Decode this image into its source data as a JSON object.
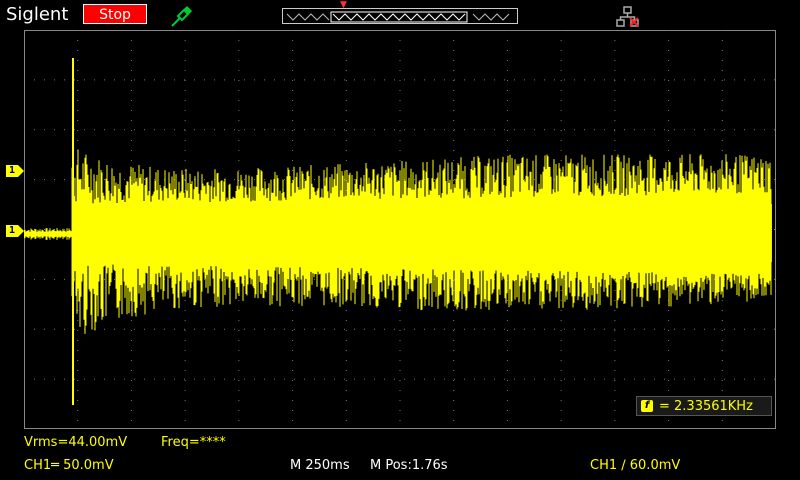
{
  "header": {
    "brand": "Siglent",
    "run_state": "Stop",
    "probe_icon": "probe-connected-icon",
    "network_icon": "network-icon"
  },
  "trigger": {
    "marker_label": "T"
  },
  "channels": {
    "ch1_marker_label": "1",
    "ch1_trigger_level_label": "1"
  },
  "measurements": {
    "vrms": "Vrms=44.00mV",
    "freq": "Freq=****"
  },
  "frequency_counter": {
    "icon_label": "f",
    "value": "= 2.33561KHz"
  },
  "status_bar": {
    "ch1_scale": "CH1═ 50.0mV",
    "timebase": "M 250ms",
    "position": "M Pos:1.76s",
    "trigger": "CH1 ∕ 60.0mV"
  },
  "colors": {
    "trace": "#ffff00",
    "grid": "#777777",
    "background": "#000000",
    "stop_button": "#ff0000"
  }
}
